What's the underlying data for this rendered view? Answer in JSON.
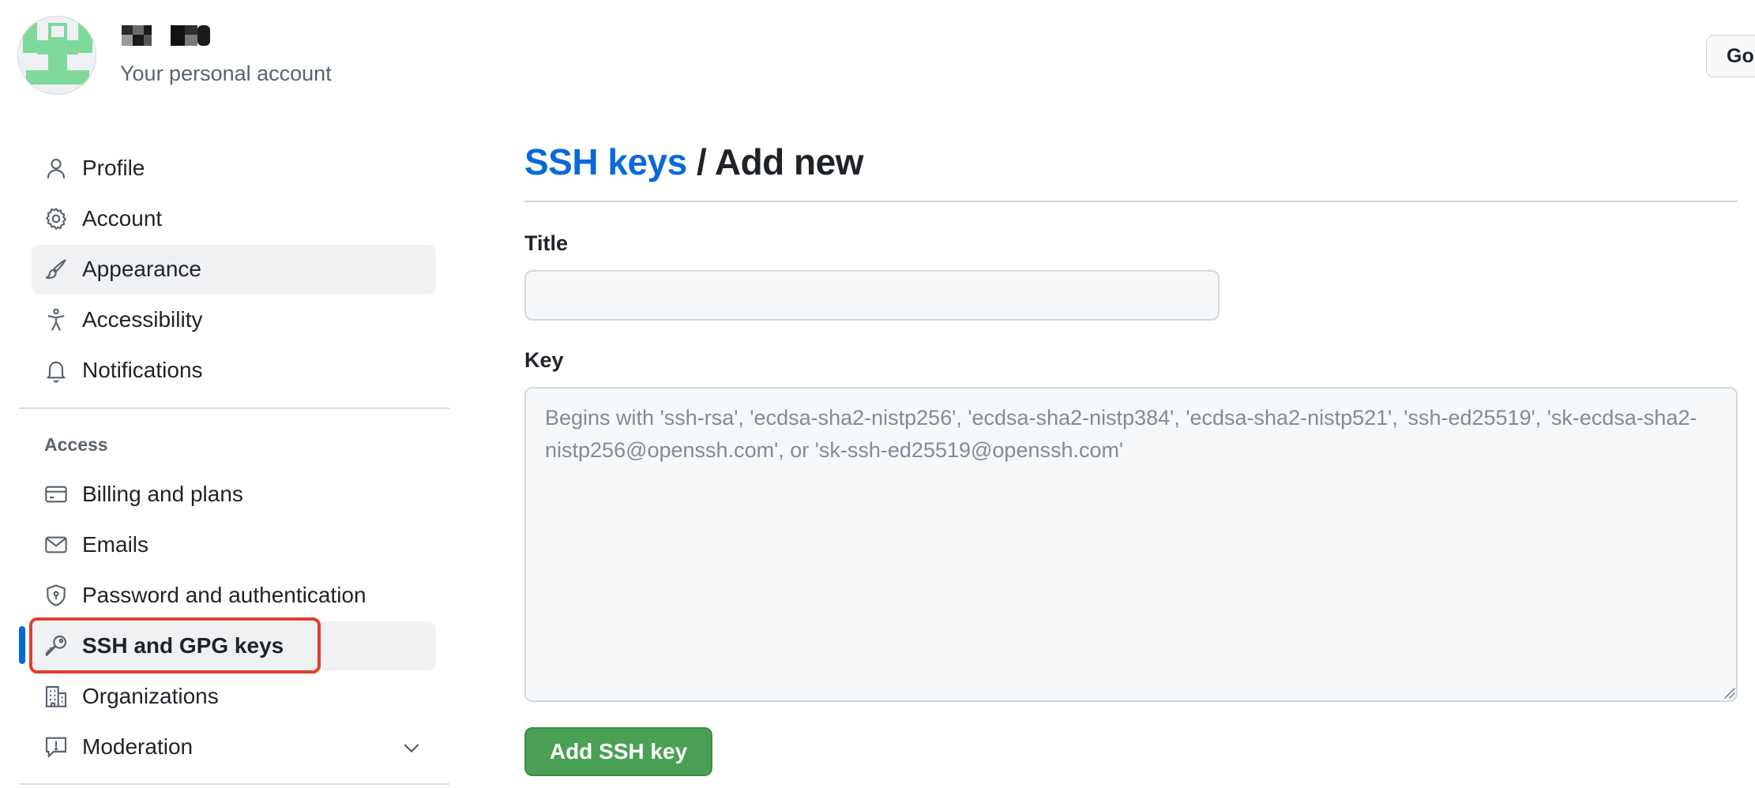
{
  "header": {
    "username": "■■ ■■",
    "account_subtitle": "Your personal account",
    "go_button_label": "Go"
  },
  "sidebar": {
    "items": [
      {
        "label": "Profile",
        "icon": "person-icon"
      },
      {
        "label": "Account",
        "icon": "gear-icon"
      },
      {
        "label": "Appearance",
        "icon": "paintbrush-icon"
      },
      {
        "label": "Accessibility",
        "icon": "accessibility-icon"
      },
      {
        "label": "Notifications",
        "icon": "bell-icon"
      }
    ],
    "access_heading": "Access",
    "access_items": [
      {
        "label": "Billing and plans",
        "icon": "credit-card-icon"
      },
      {
        "label": "Emails",
        "icon": "mail-icon"
      },
      {
        "label": "Password and authentication",
        "icon": "shield-lock-icon"
      },
      {
        "label": "SSH and GPG keys",
        "icon": "key-icon"
      },
      {
        "label": "Organizations",
        "icon": "organization-icon"
      },
      {
        "label": "Moderation",
        "icon": "report-icon"
      }
    ],
    "active_item": "SSH and GPG keys",
    "hovered_item": "Appearance"
  },
  "main": {
    "breadcrumb_link": "SSH keys",
    "breadcrumb_separator": " / ",
    "breadcrumb_current": "Add new",
    "title_label": "Title",
    "title_value": "",
    "key_label": "Key",
    "key_value": "",
    "key_placeholder": "Begins with 'ssh-rsa', 'ecdsa-sha2-nistp256', 'ecdsa-sha2-nistp384', 'ecdsa-sha2-nistp521', 'ssh-ed25519', 'sk-ecdsa-sha2-nistp256@openssh.com', or 'sk-ssh-ed25519@openssh.com'",
    "submit_label": "Add SSH key"
  },
  "colors": {
    "link_blue": "#0969da",
    "active_indicator": "#0969da",
    "primary_button": "#4aa055",
    "highlight_annotation": "#e03e2d",
    "avatar_green": "#7fd99a"
  }
}
